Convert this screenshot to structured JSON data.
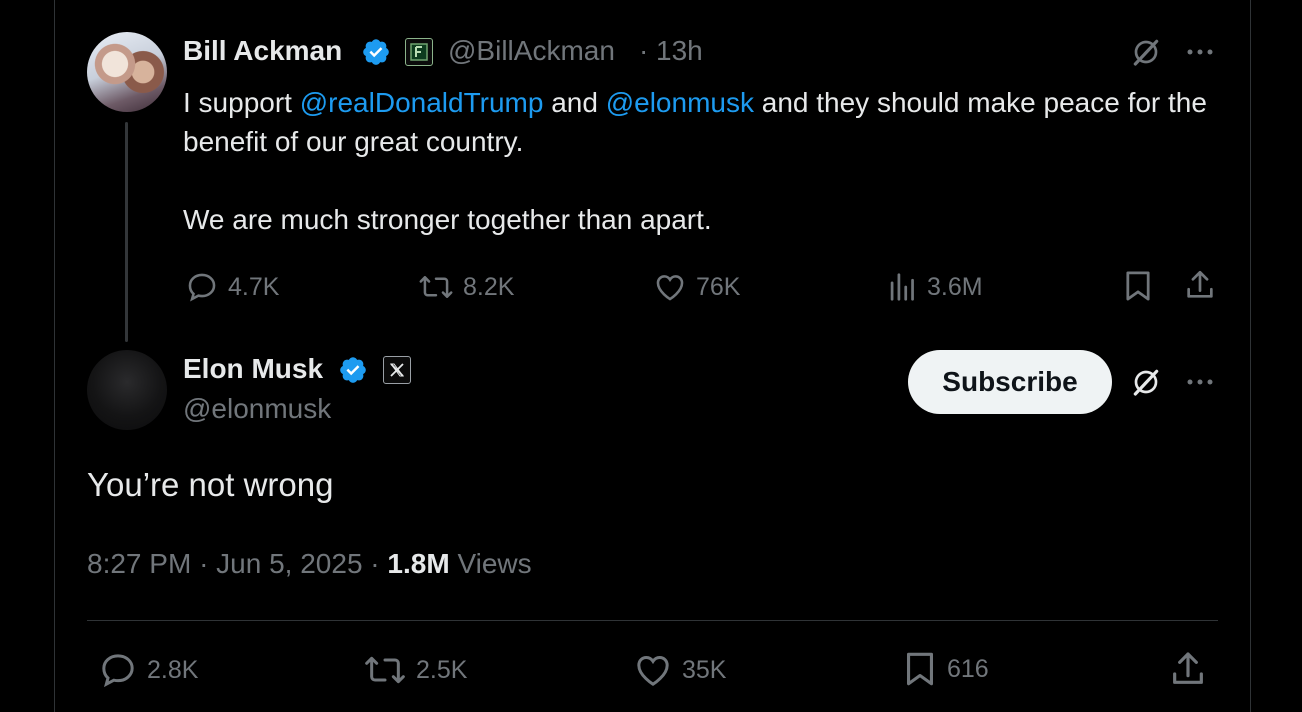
{
  "parent_tweet": {
    "author_name": "Bill Ackman",
    "author_handle": "@BillAckman",
    "separator": "·",
    "time_ago": "13h",
    "text_parts": {
      "pre": "I support ",
      "mention1": "@realDonaldTrump",
      "mid": " and ",
      "mention2": "@elonmusk",
      "post": " and they should make peace for the benefit of our great country."
    },
    "text_line2": "We are much stronger together than apart.",
    "stats": {
      "replies": "4.7K",
      "reposts": "8.2K",
      "likes": "76K",
      "views": "3.6M"
    }
  },
  "main_tweet": {
    "author_name": "Elon Musk",
    "author_handle": "@elonmusk",
    "subscribe_label": "Subscribe",
    "text": "You’re not wrong",
    "time": "8:27 PM",
    "sep1": "·",
    "date": "Jun 5, 2025",
    "sep2": "·",
    "views_count": "1.8M",
    "views_label": "Views",
    "stats": {
      "replies": "2.8K",
      "reposts": "2.5K",
      "likes": "35K",
      "bookmarks": "616"
    }
  },
  "colors": {
    "background": "#000000",
    "text": "#e7e9ea",
    "muted": "#71767b",
    "link": "#1d9bf0",
    "verified": "#1d9bf0",
    "divider": "#2f3336"
  },
  "icons": [
    "verified-badge-icon",
    "affiliate-badge-icon",
    "x-logo-icon",
    "grok-icon",
    "more-icon",
    "reply-icon",
    "repost-icon",
    "like-icon",
    "views-icon",
    "bookmark-icon",
    "share-icon"
  ]
}
